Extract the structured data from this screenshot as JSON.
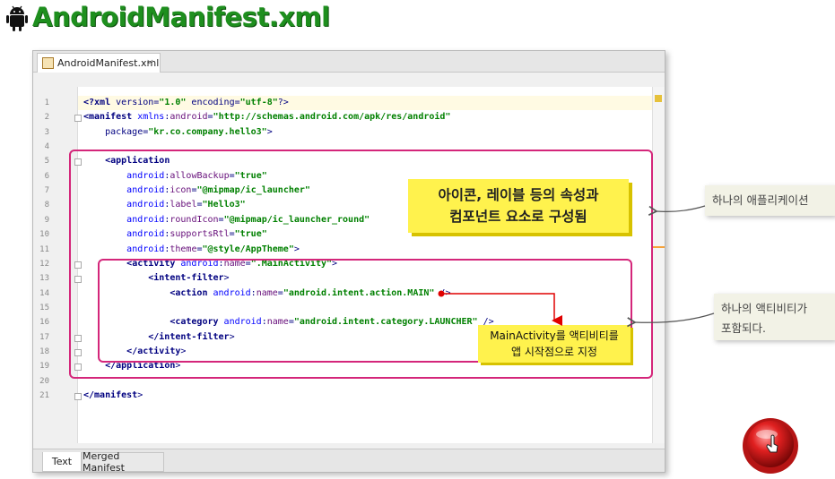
{
  "page": {
    "title": "AndroidManifest.xml",
    "icon": "android-robot-icon"
  },
  "ide": {
    "file_tab": "AndroidManifest.xml",
    "file_tab_close": "×",
    "bottom_tabs": [
      "Text",
      "Merged Manifest"
    ],
    "active_bottom_tab": "Text"
  },
  "code": {
    "line_numbers": [
      "1",
      "2",
      "3",
      "4",
      "5",
      "6",
      "7",
      "8",
      "9",
      "10",
      "11",
      "12",
      "13",
      "14",
      "15",
      "16",
      "17",
      "18",
      "19",
      "20",
      "21"
    ],
    "lines": [
      "<?xml version=\"1.0\" encoding=\"utf-8\"?>",
      "<manifest xmlns:android=\"http://schemas.android.com/apk/res/android\"",
      "    package=\"kr.co.company.hello3\">",
      "",
      "    <application",
      "        android:allowBackup=\"true\"",
      "        android:icon=\"@mipmap/ic_launcher\"",
      "        android:label=\"Hello3\"",
      "        android:roundIcon=\"@mipmap/ic_launcher_round\"",
      "        android:supportsRtl=\"true\"",
      "        android:theme=\"@style/AppTheme\">",
      "        <activity android:name=\".MainActivity\">",
      "            <intent-filter>",
      "                <action android:name=\"android.intent.action.MAIN\" />",
      "",
      "                <category android:name=\"android.intent.category.LAUNCHER\" />",
      "            </intent-filter>",
      "        </activity>",
      "    </application>",
      "",
      "</manifest>"
    ]
  },
  "annotations": {
    "app_note_line1": "아이콘, 레이블 등의 속성과",
    "app_note_line2": "컴포넌트 요소로 구성됨",
    "activity_note_line1": "MainActivity를 액티비티를",
    "activity_note_line2": "앱 시작점으로 지정",
    "side_note_app": "하나의 애플리케이션",
    "side_note_activity_line1": "하나의 액티비티가",
    "side_note_activity_line2": "포함되다."
  },
  "colors": {
    "title_green": "#1e8f1e",
    "highlight_box": "#d4267a",
    "note_yellow": "#fff24d",
    "arrow_red": "#e00000",
    "record_red": "#d01818"
  }
}
